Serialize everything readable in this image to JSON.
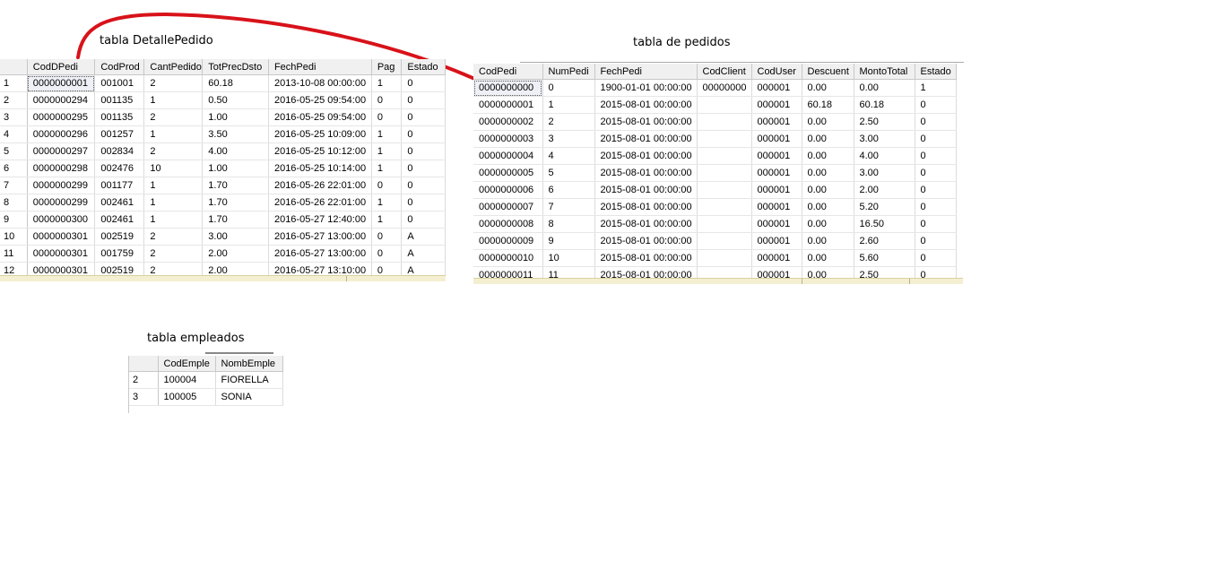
{
  "labels": {
    "detalle": "tabla DetallePedido",
    "pedidos": "tabla de pedidos",
    "empleados": "tabla empleados"
  },
  "colors": {
    "arrow": "#d8121a",
    "header": "#f0f0f0",
    "scroll": "#f4efd0"
  },
  "detalle": {
    "headers": [
      "",
      "CodDPedi",
      "CodProd",
      "CantPedido",
      "TotPrecDsto",
      "FechPedi",
      "Pag",
      "Estado"
    ],
    "rows": [
      [
        "1",
        "0000000001",
        "001001",
        "2",
        "60.18",
        "2013-10-08 00:00:00",
        "1",
        "0"
      ],
      [
        "2",
        "0000000294",
        "001135",
        "1",
        "0.50",
        "2016-05-25 09:54:00",
        "0",
        "0"
      ],
      [
        "3",
        "0000000295",
        "001135",
        "2",
        "1.00",
        "2016-05-25 09:54:00",
        "0",
        "0"
      ],
      [
        "4",
        "0000000296",
        "001257",
        "1",
        "3.50",
        "2016-05-25 10:09:00",
        "1",
        "0"
      ],
      [
        "5",
        "0000000297",
        "002834",
        "2",
        "4.00",
        "2016-05-25 10:12:00",
        "1",
        "0"
      ],
      [
        "6",
        "0000000298",
        "002476",
        "10",
        "1.00",
        "2016-05-25 10:14:00",
        "1",
        "0"
      ],
      [
        "7",
        "0000000299",
        "001177",
        "1",
        "1.70",
        "2016-05-26 22:01:00",
        "0",
        "0"
      ],
      [
        "8",
        "0000000299",
        "002461",
        "1",
        "1.70",
        "2016-05-26 22:01:00",
        "1",
        "0"
      ],
      [
        "9",
        "0000000300",
        "002461",
        "1",
        "1.70",
        "2016-05-27 12:40:00",
        "1",
        "0"
      ],
      [
        "10",
        "0000000301",
        "002519",
        "2",
        "3.00",
        "2016-05-27 13:00:00",
        "0",
        "A"
      ],
      [
        "11",
        "0000000301",
        "001759",
        "2",
        "2.00",
        "2016-05-27 13:00:00",
        "0",
        "A"
      ],
      [
        "12",
        "0000000301",
        "002519",
        "2",
        "2.00",
        "2016-05-27 13:10:00",
        "0",
        "A"
      ]
    ]
  },
  "pedidos": {
    "headers": [
      "CodPedi",
      "NumPedi",
      "FechPedi",
      "CodClient",
      "CodUser",
      "Descuent",
      "MontoTotal",
      "Estado"
    ],
    "rows": [
      [
        "0000000000",
        "0",
        "1900-01-01 00:00:00",
        "00000000",
        "000001",
        "0.00",
        "0.00",
        "1"
      ],
      [
        "0000000001",
        "1",
        "2015-08-01 00:00:00",
        "",
        "000001",
        "60.18",
        "60.18",
        "0"
      ],
      [
        "0000000002",
        "2",
        "2015-08-01 00:00:00",
        "",
        "000001",
        "0.00",
        "2.50",
        "0"
      ],
      [
        "0000000003",
        "3",
        "2015-08-01 00:00:00",
        "",
        "000001",
        "0.00",
        "3.00",
        "0"
      ],
      [
        "0000000004",
        "4",
        "2015-08-01 00:00:00",
        "",
        "000001",
        "0.00",
        "4.00",
        "0"
      ],
      [
        "0000000005",
        "5",
        "2015-08-01 00:00:00",
        "",
        "000001",
        "0.00",
        "3.00",
        "0"
      ],
      [
        "0000000006",
        "6",
        "2015-08-01 00:00:00",
        "",
        "000001",
        "0.00",
        "2.00",
        "0"
      ],
      [
        "0000000007",
        "7",
        "2015-08-01 00:00:00",
        "",
        "000001",
        "0.00",
        "5.20",
        "0"
      ],
      [
        "0000000008",
        "8",
        "2015-08-01 00:00:00",
        "",
        "000001",
        "0.00",
        "16.50",
        "0"
      ],
      [
        "0000000009",
        "9",
        "2015-08-01 00:00:00",
        "",
        "000001",
        "0.00",
        "2.60",
        "0"
      ],
      [
        "0000000010",
        "10",
        "2015-08-01 00:00:00",
        "",
        "000001",
        "0.00",
        "5.60",
        "0"
      ],
      [
        "0000000011",
        "11",
        "2015-08-01 00:00:00",
        "",
        "000001",
        "0.00",
        "2.50",
        "0"
      ]
    ]
  },
  "empleados": {
    "headers": [
      "",
      "CodEmple",
      "NombEmple"
    ],
    "rows": [
      [
        "2",
        "100004",
        "FIORELLA"
      ],
      [
        "3",
        "100005",
        "SONIA"
      ]
    ]
  }
}
